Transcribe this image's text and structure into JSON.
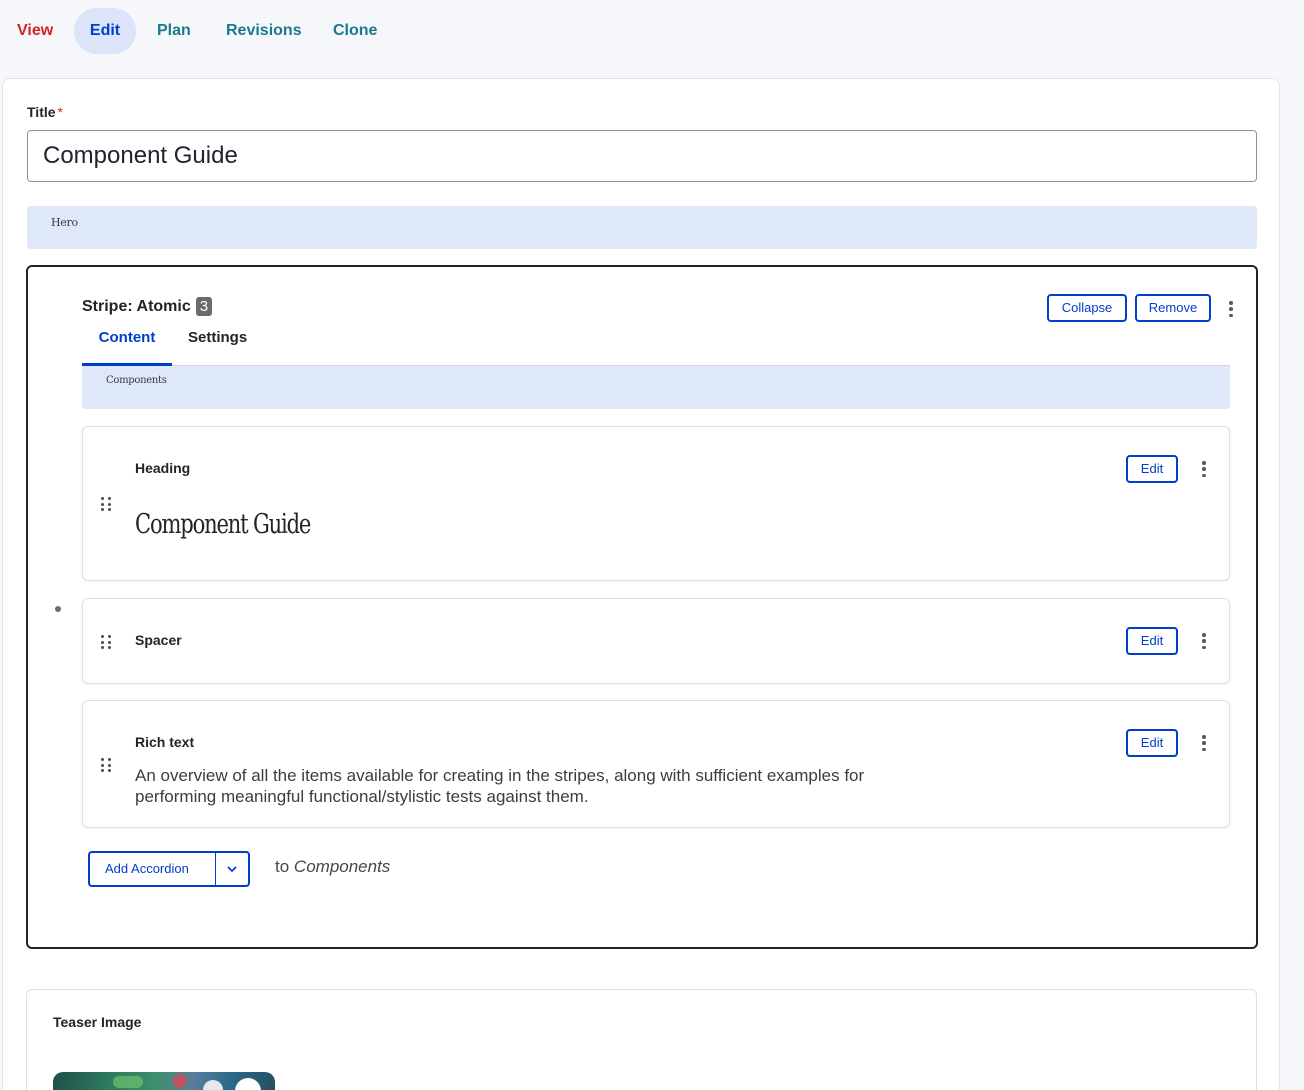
{
  "tabs": {
    "view": "View",
    "edit": "Edit",
    "plan": "Plan",
    "revisions": "Revisions",
    "clone": "Clone"
  },
  "form": {
    "title_label": "Title",
    "required_marker": "*",
    "title_value": "Component Guide",
    "hero_label": "Hero"
  },
  "stripe": {
    "title": "Stripe: Atomic",
    "count": "3",
    "collapse_label": "Collapse",
    "remove_label": "Remove",
    "tabs": {
      "content": "Content",
      "settings": "Settings"
    },
    "components_label": "Components",
    "paragraphs": [
      {
        "label": "Heading",
        "edit_label": "Edit",
        "preview": "Component Guide"
      },
      {
        "label": "Spacer",
        "edit_label": "Edit"
      },
      {
        "label": "Rich text",
        "edit_label": "Edit",
        "body": "An overview of all the items available for creating in the stripes, along with sufficient examples for performing meaningful functional/stylistic tests against them."
      }
    ],
    "add_button_label": "Add Accordion",
    "add_to_prefix": "to",
    "add_to_target": "Components"
  },
  "teaser": {
    "label": "Teaser Image"
  },
  "colors": {
    "accent": "#003ecc",
    "tab_link": "#1a7a8c",
    "view_tab": "#d72222",
    "required": "#dc2323",
    "highlight_bar": "#dfe8f9"
  },
  "icons": {
    "kebab": "kebab-menu-icon",
    "drag": "drag-handle-icon",
    "chevron": "chevron-down-icon"
  }
}
